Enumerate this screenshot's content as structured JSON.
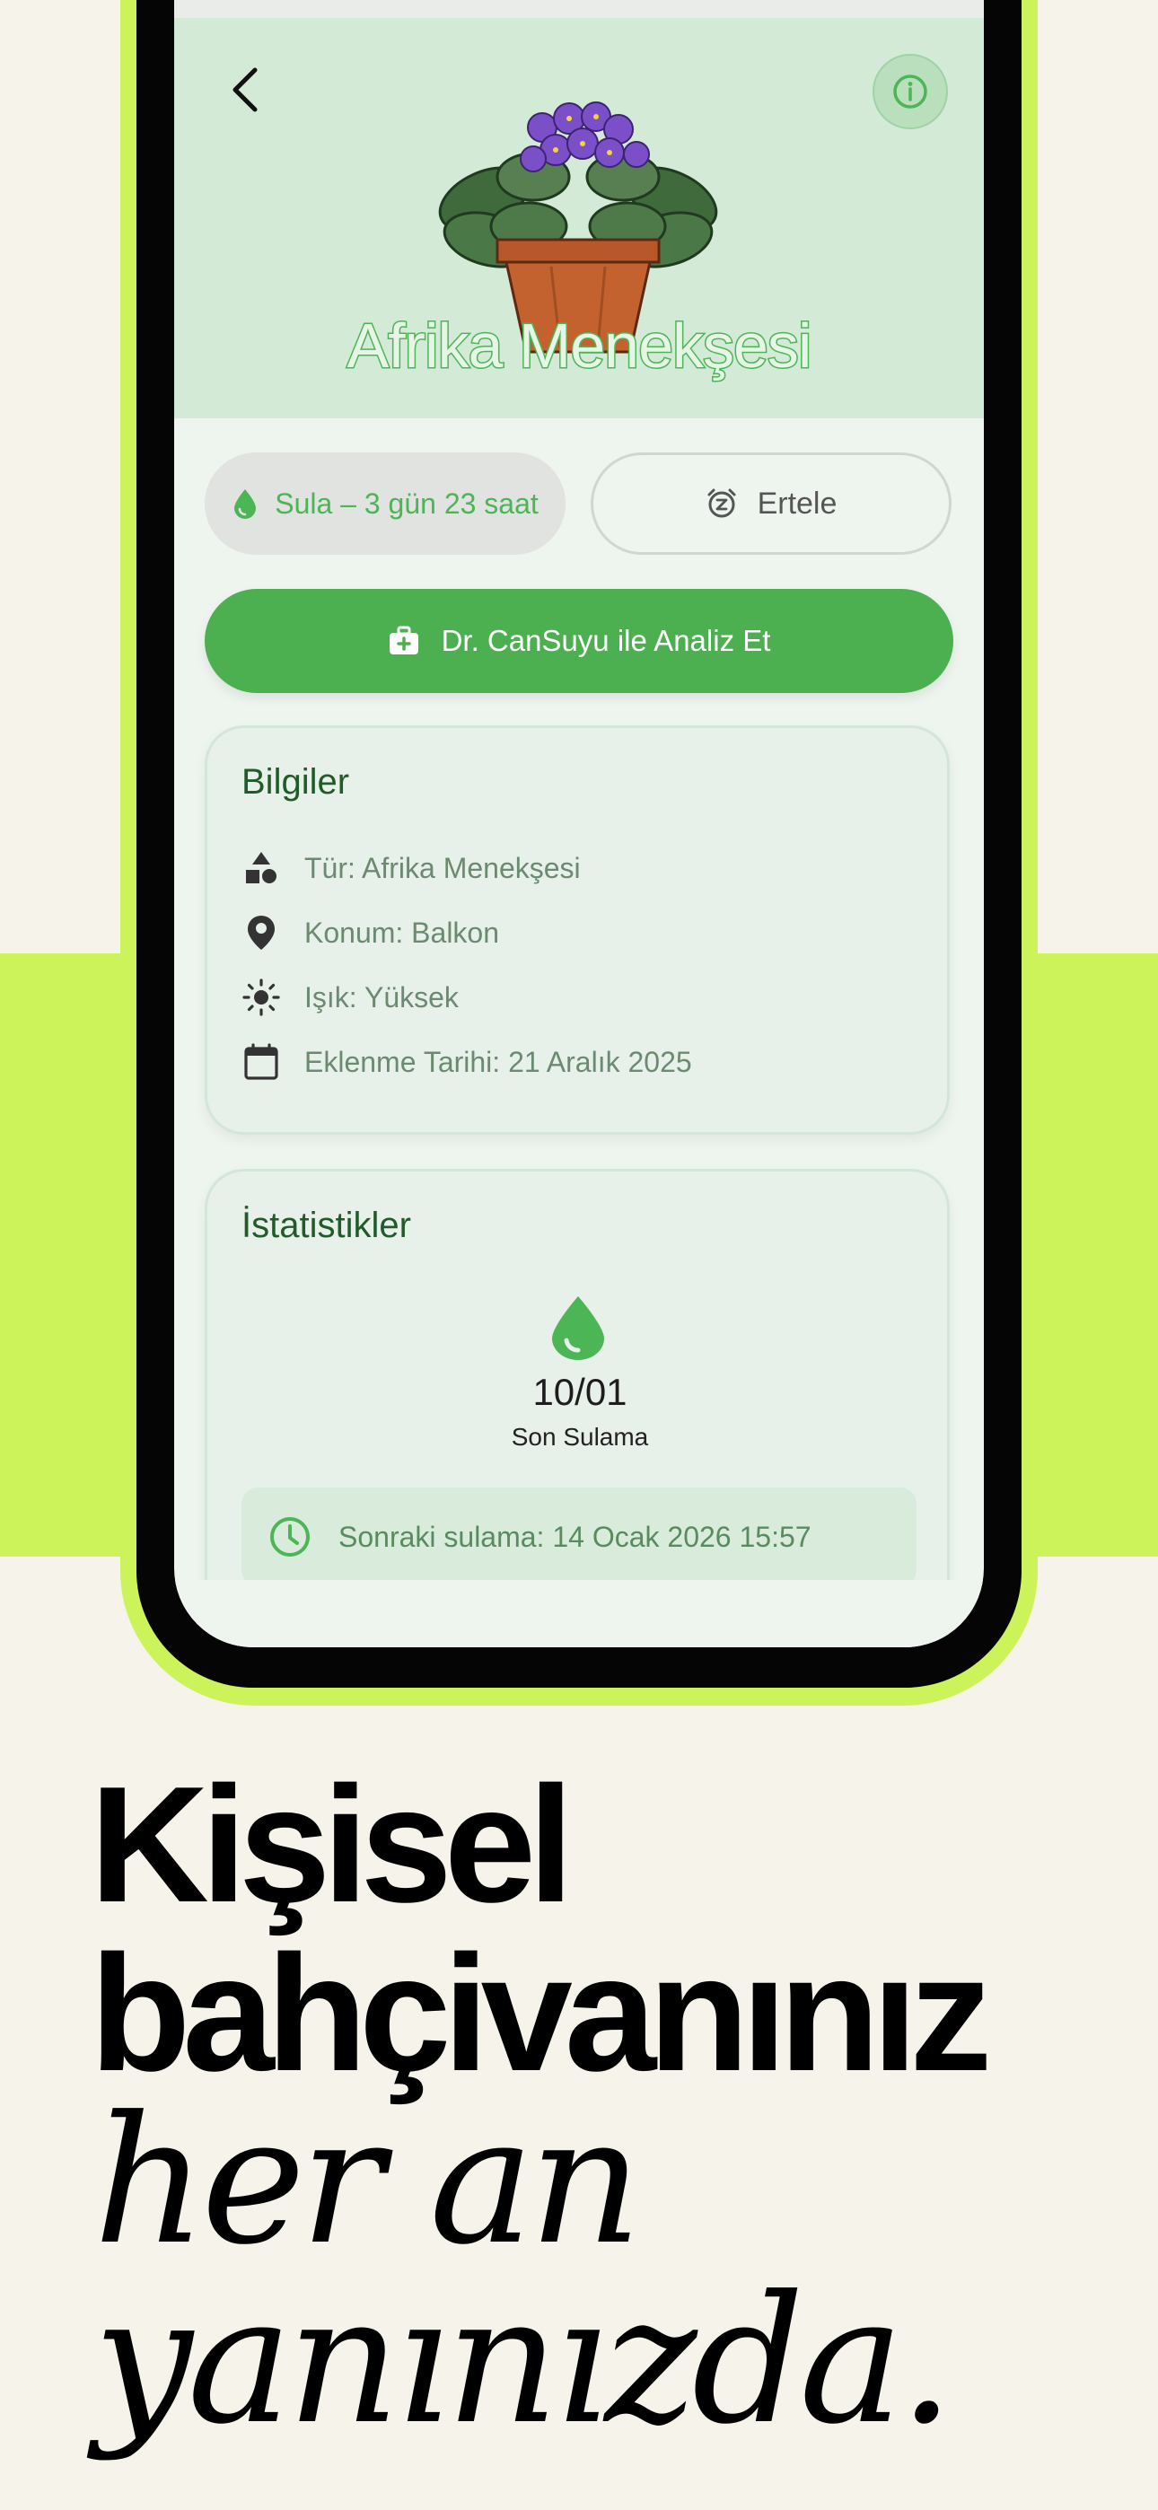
{
  "plant": {
    "name": "Afrika Menekşesi"
  },
  "actions": {
    "water_label": "Sula – 3 gün 23 saat",
    "snooze_label": "Ertele",
    "analyze_label": "Dr. CanSuyu ile Analiz Et"
  },
  "info_card": {
    "title": "Bilgiler",
    "rows": [
      {
        "icon": "shapes-icon",
        "text": "Tür: Afrika Menekşesi"
      },
      {
        "icon": "location-pin-icon",
        "text": "Konum: Balkon"
      },
      {
        "icon": "sun-icon",
        "text": "Işık: Yüksek"
      },
      {
        "icon": "calendar-icon",
        "text": "Eklenme Tarihi: 21 Aralık 2025"
      }
    ]
  },
  "stats_card": {
    "title": "İstatistikler",
    "last_water_value": "10/01",
    "last_water_label": "Son Sulama",
    "next_water_text": "Sonraki sulama: 14 Ocak 2026 15:57"
  },
  "headline": {
    "line1": "Kişisel",
    "line2": "bahçivanınız",
    "line3": "her an",
    "line4": "yanınızda."
  },
  "colors": {
    "background": "#f5f3ea",
    "lime": "#cdf35a",
    "accent_green": "#4cb051",
    "hero_green": "#d2ead6"
  }
}
